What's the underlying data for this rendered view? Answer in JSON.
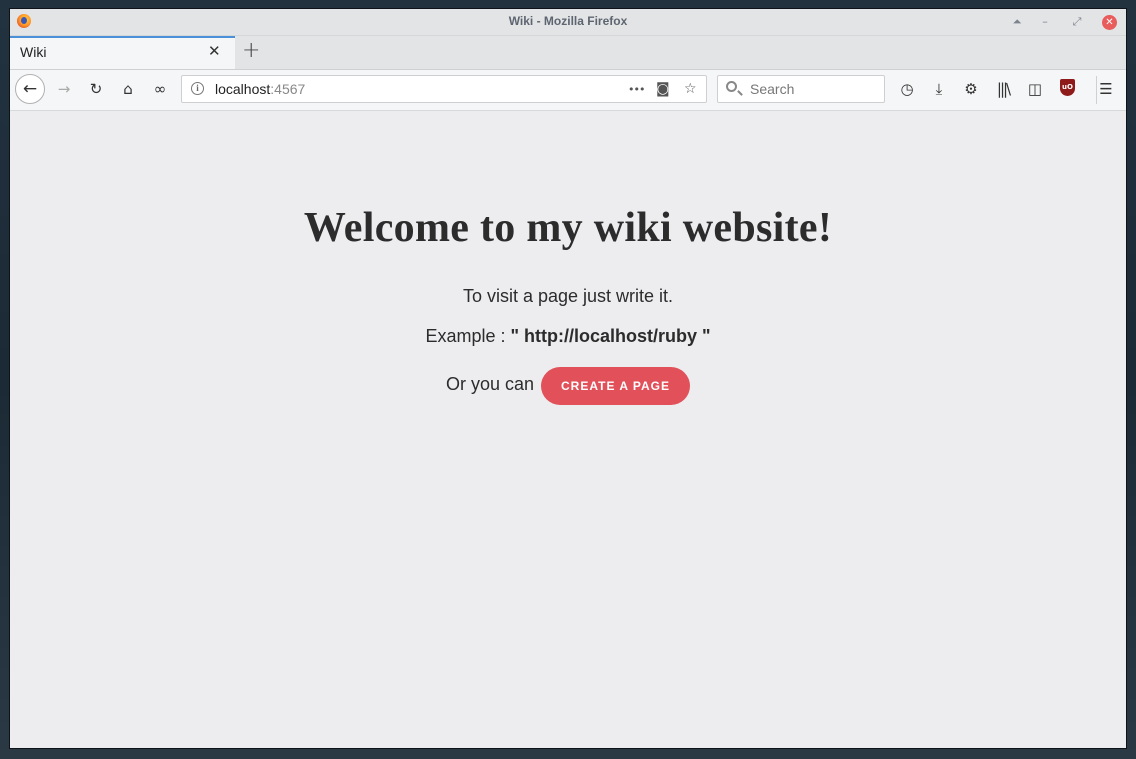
{
  "window": {
    "title": "Wiki - Mozilla Firefox"
  },
  "tabs": [
    {
      "label": "Wiki",
      "active": true
    }
  ],
  "toolbar": {
    "url_host": "localhost",
    "url_port": ":4567",
    "search_placeholder": "Search",
    "more_label": "•••"
  },
  "page": {
    "heading": "Welcome to my wiki website!",
    "intro": "To visit a page just write it.",
    "example_prefix": "Example : ",
    "example_url": "\" http://localhost/ruby \"",
    "or_text": "Or you can",
    "create_button": "CREATE A PAGE"
  },
  "colors": {
    "accent_button": "#e2515a",
    "tab_highlight": "#4a90d9",
    "page_bg": "#ededf0"
  }
}
